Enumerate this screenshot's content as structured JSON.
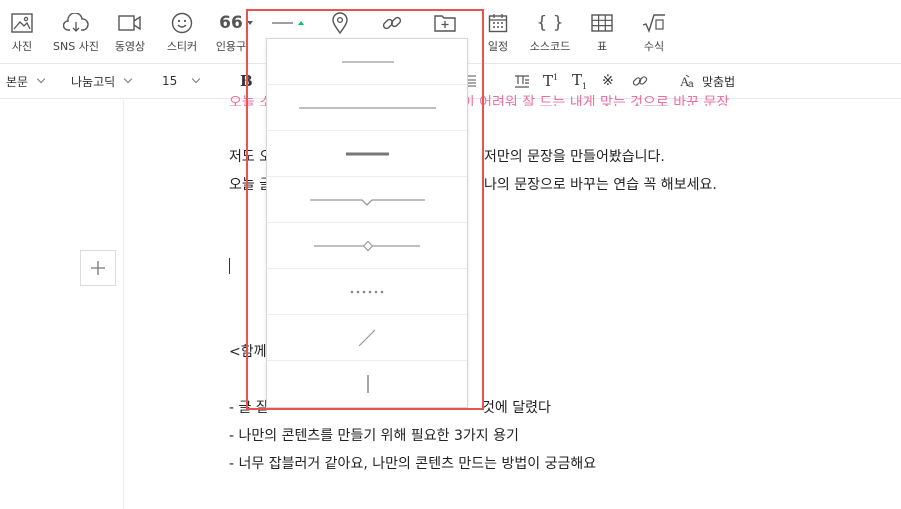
{
  "toolbar": {
    "photo": "사진",
    "sns_photo": "SNS 사진",
    "video": "동영상",
    "sticker": "스티커",
    "quote_label": "인용구",
    "quote_glyph": "66",
    "schedule": "일정",
    "source_code": "소스코드",
    "source_code_glyph": "{ }",
    "table": "표",
    "formula": "수식"
  },
  "format": {
    "paragraph": "본문",
    "font": "나눔고딕",
    "size": "15",
    "bold": "B",
    "spell_check": "맞춤법"
  },
  "editor": {
    "pink_line": "오늘 소개한 내용 중에서 마음에 드는 것이 어려워 잘 드는 내게 맞는 것으로 바꾼 문장",
    "line1_left": "저도 오",
    "line1_right": "저만의 문장을 만들어봤습니다.",
    "line2_left": "오늘 글",
    "line2_right": "나의 문장으로 바꾸는 연습 꼭 해보세요.",
    "together": "<함께",
    "bullet1_left": "- 글 잘",
    "bullet1_right": "것에 달렸다",
    "bullet2": "- 나만의 콘텐츠를 만들기 위해 필요한 3가지 용기",
    "bullet3": "- 너무 잡블러거 같아요, 나만의 콘텐츠 만드는 방법이 궁금해요"
  },
  "divider_options": [
    {
      "name": "short-thin-line"
    },
    {
      "name": "long-thin-line"
    },
    {
      "name": "thick-line"
    },
    {
      "name": "notch-line"
    },
    {
      "name": "diamond-line"
    },
    {
      "name": "dotted-line"
    },
    {
      "name": "diagonal-line"
    },
    {
      "name": "vertical-line"
    }
  ],
  "colors": {
    "accent_green": "#03c75a",
    "highlight_red": "#e8534f",
    "pink_text": "#ef6fa0"
  }
}
